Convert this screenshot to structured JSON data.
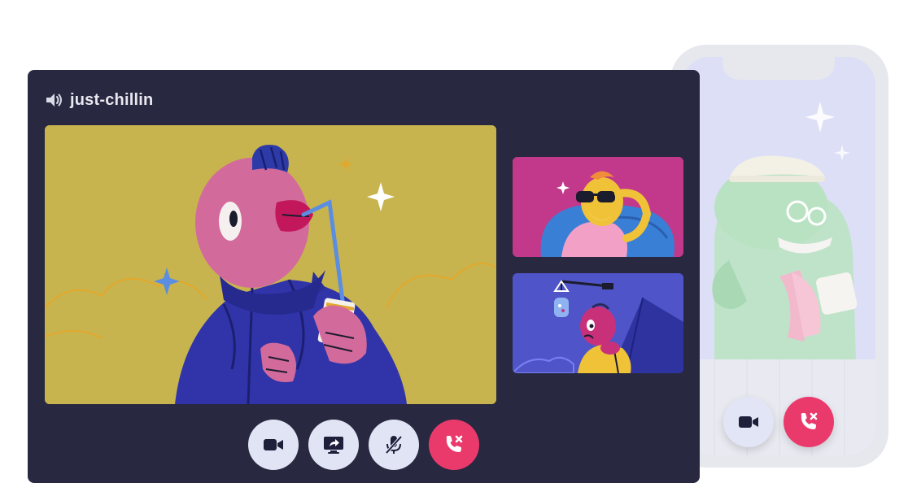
{
  "channel": {
    "name": "just-chillin",
    "icon": "speaker-icon"
  },
  "video_tiles": [
    {
      "name": "main-participant",
      "bg": "#c8b44e"
    },
    {
      "name": "participant-sunglasses",
      "bg": "#c2388a"
    },
    {
      "name": "participant-camping",
      "bg": "#4f55c8"
    }
  ],
  "controls": [
    {
      "name": "camera-button",
      "icon": "video-camera-icon"
    },
    {
      "name": "screen-share-button",
      "icon": "screen-share-icon"
    },
    {
      "name": "mute-button",
      "icon": "microphone-muted-icon"
    },
    {
      "name": "leave-call-button",
      "icon": "hang-up-icon"
    }
  ],
  "phone": {
    "controls": [
      {
        "name": "phone-camera-button",
        "icon": "video-camera-icon"
      },
      {
        "name": "phone-leave-call-button",
        "icon": "hang-up-icon"
      }
    ]
  },
  "colors": {
    "window_bg": "#282840",
    "control_bg": "#e0e4f4",
    "hangup_red": "#ea3a6c"
  }
}
